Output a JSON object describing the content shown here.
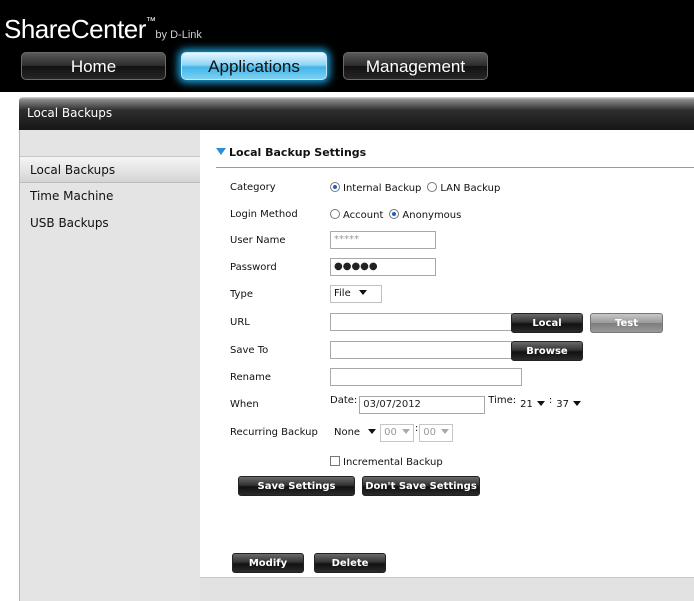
{
  "header": {
    "logo_main": "ShareCenter",
    "logo_tm": "™",
    "logo_by": "by D-Link",
    "tabs": {
      "home": "Home",
      "applications": "Applications",
      "management": "Management"
    }
  },
  "titlebar": {
    "title": "Local Backups"
  },
  "sidebar": {
    "items": [
      {
        "label": "Local Backups"
      },
      {
        "label": "Time Machine"
      },
      {
        "label": "USB Backups"
      }
    ]
  },
  "section": {
    "title": "Local Backup Settings"
  },
  "form": {
    "category": {
      "label": "Category",
      "opt1": "Internal Backup",
      "opt2": "LAN Backup",
      "selected": "Internal Backup"
    },
    "login": {
      "label": "Login Method",
      "opt1": "Account",
      "opt2": "Anonymous",
      "selected": "Anonymous"
    },
    "username": {
      "label": "User Name",
      "value": "*****"
    },
    "password": {
      "label": "Password",
      "value": "●●●●●"
    },
    "type": {
      "label": "Type",
      "value": "File"
    },
    "url": {
      "label": "URL",
      "value": "",
      "local_btn": "Local",
      "test_btn": "Test"
    },
    "saveto": {
      "label": "Save To",
      "value": "",
      "browse_btn": "Browse"
    },
    "rename": {
      "label": "Rename",
      "value": ""
    },
    "when": {
      "label": "When",
      "date_label": "Date:",
      "date": "03/07/2012",
      "time_label": "Time:",
      "hour": "21",
      "minute": "37",
      "sep": ":"
    },
    "recurring": {
      "label": "Recurring Backup",
      "freq": "None",
      "hour": "00",
      "minute": "00",
      "sep": ":"
    },
    "incremental": {
      "label": "Incremental Backup"
    }
  },
  "buttons": {
    "save": "Save Settings",
    "dont_save": "Don't Save Settings",
    "modify": "Modify",
    "delete": "Delete"
  }
}
